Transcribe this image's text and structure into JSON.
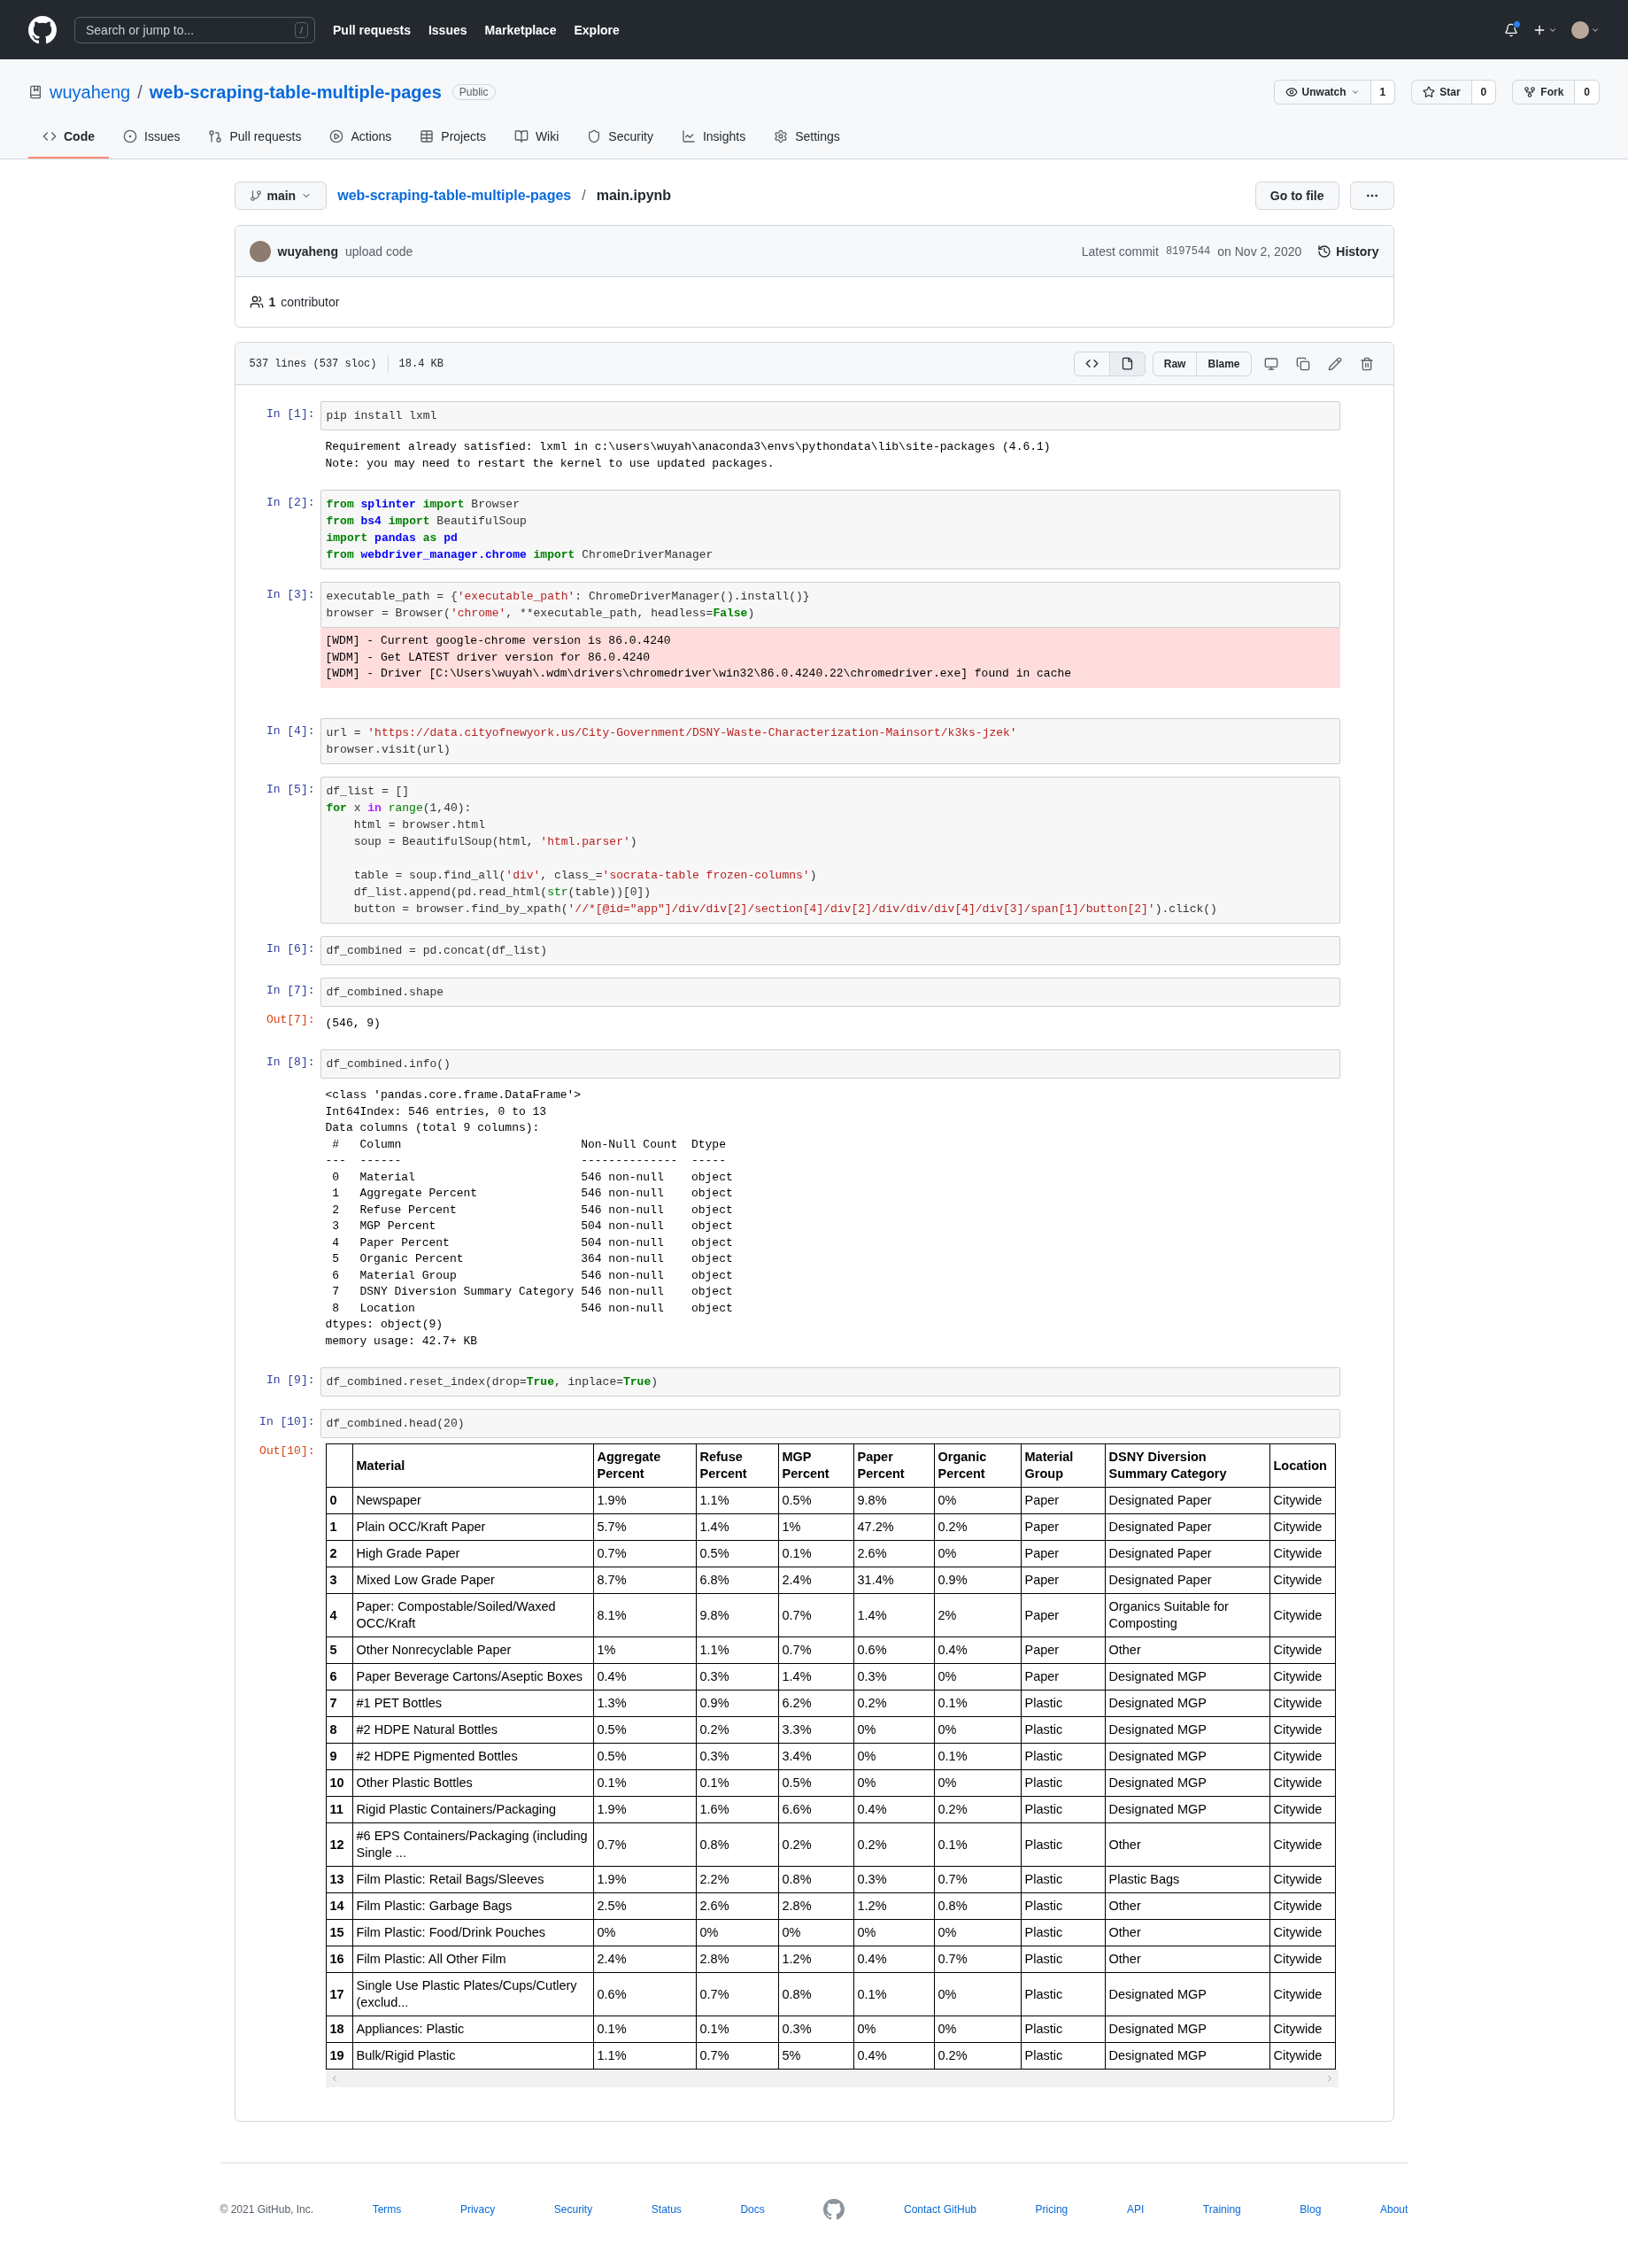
{
  "header": {
    "search_placeholder": "Search or jump to...",
    "slash_key": "/",
    "nav": [
      "Pull requests",
      "Issues",
      "Marketplace",
      "Explore"
    ]
  },
  "repo": {
    "owner": "wuyaheng",
    "separator": "/",
    "name": "web-scraping-table-multiple-pages",
    "visibility": "Public",
    "actions": [
      {
        "kind": "watch",
        "label": "Unwatch",
        "count": "1",
        "dropdown": true
      },
      {
        "kind": "star",
        "label": "Star",
        "count": "0",
        "dropdown": false
      },
      {
        "kind": "fork",
        "label": "Fork",
        "count": "0",
        "dropdown": false
      }
    ]
  },
  "tabs": [
    {
      "label": "Code",
      "selected": true
    },
    {
      "label": "Issues",
      "selected": false
    },
    {
      "label": "Pull requests",
      "selected": false
    },
    {
      "label": "Actions",
      "selected": false
    },
    {
      "label": "Projects",
      "selected": false
    },
    {
      "label": "Wiki",
      "selected": false
    },
    {
      "label": "Security",
      "selected": false
    },
    {
      "label": "Insights",
      "selected": false
    },
    {
      "label": "Settings",
      "selected": false
    }
  ],
  "breadcrumb": {
    "branch": "main",
    "repo": "web-scraping-table-multiple-pages",
    "separator": "/",
    "file": "main.ipynb",
    "go_to_file": "Go to file"
  },
  "commit": {
    "author": "wuyaheng",
    "message": "upload code",
    "prefix": "Latest commit",
    "sha": "8197544",
    "date": "on Nov 2, 2020",
    "history": "History"
  },
  "contributors": {
    "count": "1",
    "label": "contributor"
  },
  "file_info": {
    "lines": "537 lines (537 sloc)",
    "size": "18.4 KB",
    "buttons": [
      "Raw",
      "Blame"
    ]
  },
  "cells": [
    {
      "prompt": "In [1]:",
      "source": [
        [
          [
            {
              "kind": "plain",
              "text": "pip install lxml"
            }
          ]
        ]
      ],
      "outputs": [
        {
          "kind": "stream",
          "lines": [
            "Requirement already satisfied: lxml in c:\\users\\wuyah\\anaconda3\\envs\\pythondata\\lib\\site-packages (4.6.1)",
            "Note: you may need to restart the kernel to use updated packages."
          ]
        }
      ]
    },
    {
      "prompt": "In [2]:",
      "source": [
        [
          [
            {
              "kind": "keyword",
              "text": "from "
            },
            {
              "kind": "module",
              "text": "splinter"
            },
            {
              "kind": "keyword",
              "text": " import"
            },
            {
              "kind": "plain",
              "text": " Browser"
            }
          ],
          [
            {
              "kind": "keyword",
              "text": "from "
            },
            {
              "kind": "module",
              "text": "bs4"
            },
            {
              "kind": "keyword",
              "text": " import"
            },
            {
              "kind": "plain",
              "text": " BeautifulSoup"
            }
          ],
          [
            {
              "kind": "keyword",
              "text": "import "
            },
            {
              "kind": "module",
              "text": "pandas"
            },
            {
              "kind": "keyword",
              "text": " as "
            },
            {
              "kind": "module",
              "text": "pd"
            }
          ],
          [
            {
              "kind": "keyword",
              "text": "from "
            },
            {
              "kind": "module",
              "text": "webdriver_manager.chrome"
            },
            {
              "kind": "keyword",
              "text": " import"
            },
            {
              "kind": "plain",
              "text": " ChromeDriverManager"
            }
          ]
        ]
      ]
    },
    {
      "prompt": "In [3]:",
      "source": [
        [
          [
            {
              "kind": "plain",
              "text": "executable_path = {"
            },
            {
              "kind": "string",
              "text": "'executable_path'"
            },
            {
              "kind": "plain",
              "text": ": ChromeDriverManager().install()}"
            }
          ],
          [
            {
              "kind": "plain",
              "text": "browser = Browser("
            },
            {
              "kind": "string",
              "text": "'chrome'"
            },
            {
              "kind": "plain",
              "text": ", **executable_path, headless="
            },
            {
              "kind": "constant",
              "text": "False"
            },
            {
              "kind": "plain",
              "text": ")"
            }
          ]
        ]
      ],
      "outputs": [
        {
          "kind": "stderr",
          "lines": [
            "[WDM] - Current google-chrome version is 86.0.4240",
            "[WDM] - Get LATEST driver version for 86.0.4240",
            "[WDM] - Driver [C:\\Users\\wuyah\\.wdm\\drivers\\chromedriver\\win32\\86.0.4240.22\\chromedriver.exe] found in cache"
          ]
        }
      ]
    },
    {
      "prompt": "In [4]:",
      "source": [
        [
          [
            {
              "kind": "plain",
              "text": "url = "
            },
            {
              "kind": "string",
              "text": "'https://data.cityofnewyork.us/City-Government/DSNY-Waste-Characterization-Mainsort/k3ks-jzek'"
            }
          ],
          [
            {
              "kind": "plain",
              "text": "browser.visit(url)"
            }
          ]
        ]
      ]
    },
    {
      "prompt": "In [5]:",
      "source": [
        [
          [
            {
              "kind": "plain",
              "text": "df_list = []"
            }
          ],
          [
            {
              "kind": "keyword",
              "text": "for"
            },
            {
              "kind": "plain",
              "text": " x "
            },
            {
              "kind": "operator",
              "text": "in "
            },
            {
              "kind": "builtin",
              "text": "range"
            },
            {
              "kind": "plain",
              "text": "(1,40):"
            }
          ],
          [
            {
              "kind": "plain",
              "text": "    html = browser.html"
            }
          ],
          [
            {
              "kind": "plain",
              "text": "    soup = BeautifulSoup(html, "
            },
            {
              "kind": "string",
              "text": "'html.parser'"
            },
            {
              "kind": "plain",
              "text": ")"
            }
          ]
        ],
        [
          [
            {
              "kind": "plain",
              "text": "    table = soup.find_all("
            },
            {
              "kind": "string",
              "text": "'div'"
            },
            {
              "kind": "plain",
              "text": ", class_="
            },
            {
              "kind": "string",
              "text": "'socrata-table frozen-columns'"
            },
            {
              "kind": "plain",
              "text": ")"
            }
          ],
          [
            {
              "kind": "plain",
              "text": "    df_list.append(pd.read_html("
            },
            {
              "kind": "builtin",
              "text": "str"
            },
            {
              "kind": "plain",
              "text": "(table))[0])"
            }
          ],
          [
            {
              "kind": "plain",
              "text": "    button = browser.find_by_xpath("
            },
            {
              "kind": "string",
              "text": "'//*[@id=\"app\"]/div/div[2]/section[4]/div[2]/div/div/div[4]/div[3]/span[1]/button[2]'"
            },
            {
              "kind": "plain",
              "text": ").click()"
            }
          ]
        ]
      ]
    },
    {
      "prompt": "In [6]:",
      "source": [
        [
          [
            {
              "kind": "plain",
              "text": "df_combined = pd.concat(df_list)"
            }
          ]
        ]
      ]
    },
    {
      "prompt": "In [7]:",
      "source": [
        [
          [
            {
              "kind": "plain",
              "text": "df_combined.shape"
            }
          ]
        ]
      ],
      "outputs": [
        {
          "kind": "result",
          "prompt": "Out[7]:",
          "lines": [
            "(546, 9)"
          ]
        }
      ]
    },
    {
      "prompt": "In [8]:",
      "source": [
        [
          [
            {
              "kind": "plain",
              "text": "df_combined.info()"
            }
          ]
        ]
      ],
      "outputs": [
        {
          "kind": "stream",
          "lines": [
            "<class 'pandas.core.frame.DataFrame'>",
            "Int64Index: 546 entries, 0 to 13",
            "Data columns (total 9 columns):",
            " #   Column                          Non-Null Count  Dtype",
            "---  ------                          --------------  -----",
            " 0   Material                        546 non-null    object",
            " 1   Aggregate Percent               546 non-null    object",
            " 2   Refuse Percent                  546 non-null    object",
            " 3   MGP Percent                     504 non-null    object",
            " 4   Paper Percent                   504 non-null    object",
            " 5   Organic Percent                 364 non-null    object",
            " 6   Material Group                  546 non-null    object",
            " 7   DSNY Diversion Summary Category 546 non-null    object",
            " 8   Location                        546 non-null    object",
            "dtypes: object(9)",
            "memory usage: 42.7+ KB"
          ]
        }
      ]
    },
    {
      "prompt": "In [9]:",
      "source": [
        [
          [
            {
              "kind": "plain",
              "text": "df_combined.reset_index(drop="
            },
            {
              "kind": "constant",
              "text": "True"
            },
            {
              "kind": "plain",
              "text": ", inplace="
            },
            {
              "kind": "constant",
              "text": "True"
            },
            {
              "kind": "plain",
              "text": ")"
            }
          ]
        ]
      ]
    },
    {
      "prompt": "In [10]:",
      "source": [
        [
          [
            {
              "kind": "plain",
              "text": "df_combined.head(20)"
            }
          ]
        ]
      ],
      "outputs": [
        {
          "kind": "table",
          "prompt": "Out[10]:",
          "columns": [
            "Material",
            "Aggregate Percent",
            "Refuse Percent",
            "MGP Percent",
            "Paper Percent",
            "Organic Percent",
            "Material Group",
            "DSNY Diversion Summary Category",
            "Location"
          ],
          "rows": [
            {
              "index": "0",
              "cells": [
                "Newspaper",
                "1.9%",
                "1.1%",
                "0.5%",
                "9.8%",
                "0%",
                "Paper",
                "Designated Paper",
                "Citywide"
              ]
            },
            {
              "index": "1",
              "cells": [
                "Plain OCC/Kraft Paper",
                "5.7%",
                "1.4%",
                "1%",
                "47.2%",
                "0.2%",
                "Paper",
                "Designated Paper",
                "Citywide"
              ]
            },
            {
              "index": "2",
              "cells": [
                "High Grade Paper",
                "0.7%",
                "0.5%",
                "0.1%",
                "2.6%",
                "0%",
                "Paper",
                "Designated Paper",
                "Citywide"
              ]
            },
            {
              "index": "3",
              "cells": [
                "Mixed Low Grade Paper",
                "8.7%",
                "6.8%",
                "2.4%",
                "31.4%",
                "0.9%",
                "Paper",
                "Designated Paper",
                "Citywide"
              ]
            },
            {
              "index": "4",
              "cells": [
                "Paper: Compostable/Soiled/Waxed OCC/Kraft",
                "8.1%",
                "9.8%",
                "0.7%",
                "1.4%",
                "2%",
                "Paper",
                "Organics Suitable for Composting",
                "Citywide"
              ]
            },
            {
              "index": "5",
              "cells": [
                "Other Nonrecyclable Paper",
                "1%",
                "1.1%",
                "0.7%",
                "0.6%",
                "0.4%",
                "Paper",
                "Other",
                "Citywide"
              ]
            },
            {
              "index": "6",
              "cells": [
                "Paper Beverage Cartons/Aseptic Boxes",
                "0.4%",
                "0.3%",
                "1.4%",
                "0.3%",
                "0%",
                "Paper",
                "Designated MGP",
                "Citywide"
              ]
            },
            {
              "index": "7",
              "cells": [
                "#1 PET Bottles",
                "1.3%",
                "0.9%",
                "6.2%",
                "0.2%",
                "0.1%",
                "Plastic",
                "Designated MGP",
                "Citywide"
              ]
            },
            {
              "index": "8",
              "cells": [
                "#2 HDPE Natural Bottles",
                "0.5%",
                "0.2%",
                "3.3%",
                "0%",
                "0%",
                "Plastic",
                "Designated MGP",
                "Citywide"
              ]
            },
            {
              "index": "9",
              "cells": [
                "#2 HDPE Pigmented Bottles",
                "0.5%",
                "0.3%",
                "3.4%",
                "0%",
                "0.1%",
                "Plastic",
                "Designated MGP",
                "Citywide"
              ]
            },
            {
              "index": "10",
              "cells": [
                "Other Plastic Bottles",
                "0.1%",
                "0.1%",
                "0.5%",
                "0%",
                "0%",
                "Plastic",
                "Designated MGP",
                "Citywide"
              ]
            },
            {
              "index": "11",
              "cells": [
                "Rigid Plastic Containers/Packaging",
                "1.9%",
                "1.6%",
                "6.6%",
                "0.4%",
                "0.2%",
                "Plastic",
                "Designated MGP",
                "Citywide"
              ]
            },
            {
              "index": "12",
              "cells": [
                "#6 EPS Containers/Packaging (including Single ...",
                "0.7%",
                "0.8%",
                "0.2%",
                "0.2%",
                "0.1%",
                "Plastic",
                "Other",
                "Citywide"
              ]
            },
            {
              "index": "13",
              "cells": [
                "Film Plastic: Retail Bags/Sleeves",
                "1.9%",
                "2.2%",
                "0.8%",
                "0.3%",
                "0.7%",
                "Plastic",
                "Plastic Bags",
                "Citywide"
              ]
            },
            {
              "index": "14",
              "cells": [
                "Film Plastic: Garbage Bags",
                "2.5%",
                "2.6%",
                "2.8%",
                "1.2%",
                "0.8%",
                "Plastic",
                "Other",
                "Citywide"
              ]
            },
            {
              "index": "15",
              "cells": [
                "Film Plastic: Food/Drink Pouches",
                "0%",
                "0%",
                "0%",
                "0%",
                "0%",
                "Plastic",
                "Other",
                "Citywide"
              ]
            },
            {
              "index": "16",
              "cells": [
                "Film Plastic: All Other Film",
                "2.4%",
                "2.8%",
                "1.2%",
                "0.4%",
                "0.7%",
                "Plastic",
                "Other",
                "Citywide"
              ]
            },
            {
              "index": "17",
              "cells": [
                "Single Use Plastic Plates/Cups/Cutlery (exclud...",
                "0.6%",
                "0.7%",
                "0.8%",
                "0.1%",
                "0%",
                "Plastic",
                "Designated MGP",
                "Citywide"
              ]
            },
            {
              "index": "18",
              "cells": [
                "Appliances: Plastic",
                "0.1%",
                "0.1%",
                "0.3%",
                "0%",
                "0%",
                "Plastic",
                "Designated MGP",
                "Citywide"
              ]
            },
            {
              "index": "19",
              "cells": [
                "Bulk/Rigid Plastic",
                "1.1%",
                "0.7%",
                "5%",
                "0.4%",
                "0.2%",
                "Plastic",
                "Designated MGP",
                "Citywide"
              ]
            }
          ]
        }
      ]
    }
  ],
  "footer": {
    "copyright": "© 2021 GitHub, Inc.",
    "links_left": [
      "Terms",
      "Privacy",
      "Security",
      "Status",
      "Docs"
    ],
    "links_right": [
      "Contact GitHub",
      "Pricing",
      "API",
      "Training",
      "Blog",
      "About"
    ]
  }
}
